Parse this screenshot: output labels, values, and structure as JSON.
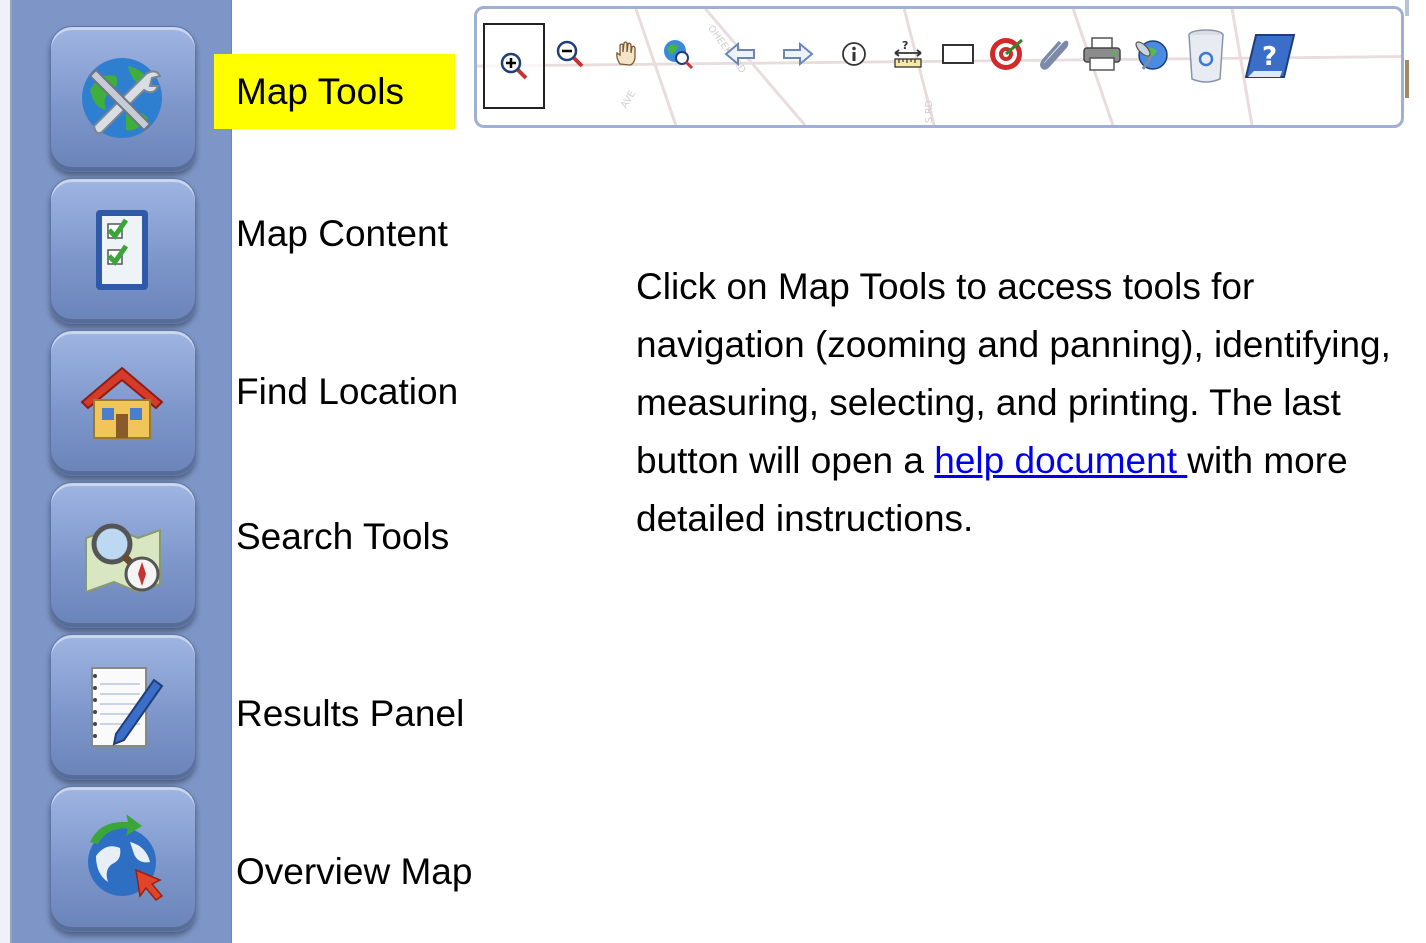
{
  "sidebar": {
    "buttons": [
      {
        "label": "Map Tools",
        "icon": "globe-wrench-icon"
      },
      {
        "label": "Map Content",
        "icon": "checklist-icon"
      },
      {
        "label": "Find Location",
        "icon": "house-icon"
      },
      {
        "label": "Search Tools",
        "icon": "magnifier-map-icon"
      },
      {
        "label": "Results Panel",
        "icon": "notepad-pen-icon"
      },
      {
        "label": "Overview Map",
        "icon": "globe-arrows-icon"
      }
    ]
  },
  "toolbar": {
    "tools": [
      "zoom-in-icon",
      "zoom-out-icon",
      "pan-hand-icon",
      "full-extent-icon",
      "back-arrow-icon",
      "forward-arrow-icon",
      "identify-icon",
      "measure-icon",
      "select-rectangle-icon",
      "target-icon",
      "paperclip-icon",
      "printer-icon",
      "satellite-icon",
      "clear-bin-icon",
      "help-book-icon"
    ],
    "map_road_labels": [
      "AVE",
      "OHEEKE RD",
      "S RD"
    ]
  },
  "description": {
    "text_before_link": "Click on Map Tools to access tools for navigation (zooming and panning), identifying, measuring, selecting, and printing. The last button will open a ",
    "link_text": "help document ",
    "text_after_link": "with more detailed instructions."
  },
  "colors": {
    "sidebar": "#7d96c7",
    "highlight": "#ffff00",
    "link": "#0000ee"
  }
}
